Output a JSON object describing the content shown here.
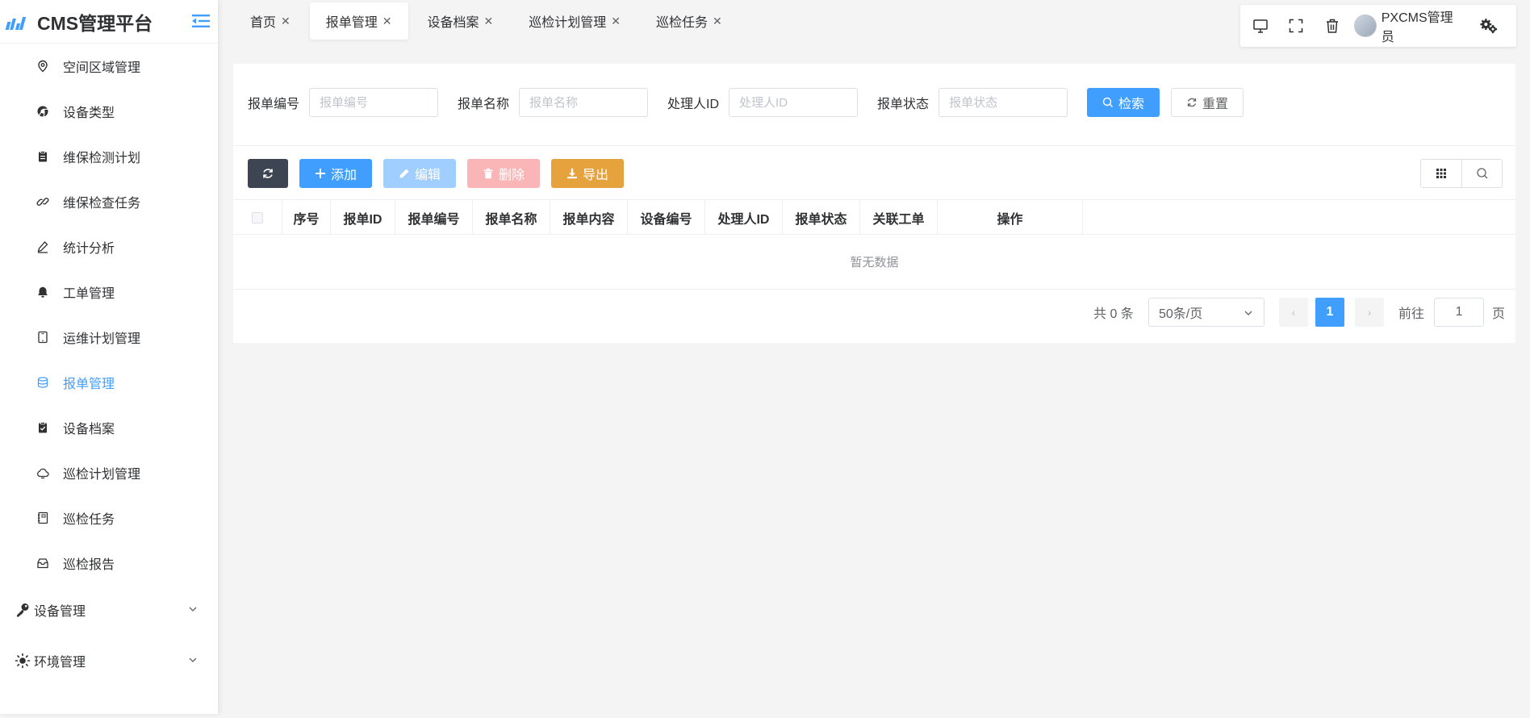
{
  "app": {
    "title": "CMS管理平台"
  },
  "sidebar": {
    "items": [
      {
        "label": "空间区域管理",
        "icon": "location-icon"
      },
      {
        "label": "设备类型",
        "icon": "chrome-icon"
      },
      {
        "label": "维保检测计划",
        "icon": "clipboard-icon"
      },
      {
        "label": "维保检查任务",
        "icon": "link-icon"
      },
      {
        "label": "统计分析",
        "icon": "edit-pen-icon"
      },
      {
        "label": "工单管理",
        "icon": "bell-icon"
      },
      {
        "label": "运维计划管理",
        "icon": "tablet-icon"
      },
      {
        "label": "报单管理",
        "icon": "coin-icon",
        "active": true
      },
      {
        "label": "设备档案",
        "icon": "checked-doc-icon"
      },
      {
        "label": "巡检计划管理",
        "icon": "cloudy-icon"
      },
      {
        "label": "巡检任务",
        "icon": "notebook-icon"
      },
      {
        "label": "巡检报告",
        "icon": "box-icon"
      }
    ],
    "groups": [
      {
        "label": "设备管理",
        "icon": "key-icon"
      },
      {
        "label": "环境管理",
        "icon": "sunny-icon"
      }
    ]
  },
  "tabs": [
    {
      "label": "首页"
    },
    {
      "label": "报单管理",
      "active": true
    },
    {
      "label": "设备档案"
    },
    {
      "label": "巡检计划管理"
    },
    {
      "label": "巡检任务"
    }
  ],
  "header": {
    "user_name": "PXCMS管理员"
  },
  "search": {
    "fields": [
      {
        "label": "报单编号",
        "placeholder": "报单编号"
      },
      {
        "label": "报单名称",
        "placeholder": "报单名称"
      },
      {
        "label": "处理人ID",
        "placeholder": "处理人ID"
      },
      {
        "label": "报单状态",
        "placeholder": "报单状态"
      }
    ],
    "search_label": "检索",
    "reset_label": "重置"
  },
  "toolbar": {
    "add_label": "添加",
    "edit_label": "编辑",
    "delete_label": "删除",
    "export_label": "导出"
  },
  "table": {
    "columns": [
      "序号",
      "报单ID",
      "报单编号",
      "报单名称",
      "报单内容",
      "设备编号",
      "处理人ID",
      "报单状态",
      "关联工单",
      "操作"
    ],
    "empty_text": "暂无数据"
  },
  "pagination": {
    "total_text": "共 0 条",
    "page_size": "50条/页",
    "current_page": "1",
    "goto_label": "前往",
    "goto_value": "1",
    "page_suffix": "页"
  },
  "colors": {
    "primary": "#409eff",
    "dark": "#3d4552",
    "warning": "#e6a23c",
    "danger_disabled": "#fab6b6",
    "primary_disabled": "#a0cfff"
  }
}
